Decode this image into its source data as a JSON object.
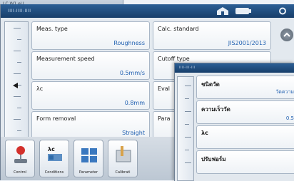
{
  "back_screen": {
    "label": "LC W1 eU"
  },
  "main": {
    "title": "IIII-IIII-IIII",
    "params": [
      {
        "label": "Meas. type",
        "value": "Roughness"
      },
      {
        "label": "Calc. standard",
        "value": "JIS2001/2013"
      },
      {
        "label": "Measurement speed",
        "value": "0.5mm/s"
      },
      {
        "label": "Cutoff type",
        "value": ""
      },
      {
        "label": "λc",
        "value": "0.8mm"
      },
      {
        "label": "Eval",
        "value": ""
      },
      {
        "label": "Form removal",
        "value": "Straight"
      },
      {
        "label": "Para",
        "value": ""
      }
    ],
    "dock": [
      {
        "label": "Control",
        "icon": "joystick-icon"
      },
      {
        "label": "Conditions",
        "icon": "conditions-icon"
      },
      {
        "label": "Parameter",
        "icon": "parameter-icon"
      },
      {
        "label": "Calibrati",
        "icon": "calibration-icon"
      }
    ],
    "dock_art": {
      "conditions_text": "λc",
      "parameter_text": "Ra Rz Rq Rp"
    }
  },
  "overlay": {
    "title": "IIII-III-III",
    "params": [
      {
        "label": "ชนิดวัด",
        "value": "วัดความ"
      },
      {
        "label": "ความเร็ววัด",
        "value": "0.5"
      },
      {
        "label": "λc",
        "value": ""
      },
      {
        "label": "ปรับฟอร์ม",
        "value": ""
      }
    ]
  },
  "colors": {
    "title_bar": "#234f80",
    "value_text": "#1f5fb0"
  }
}
